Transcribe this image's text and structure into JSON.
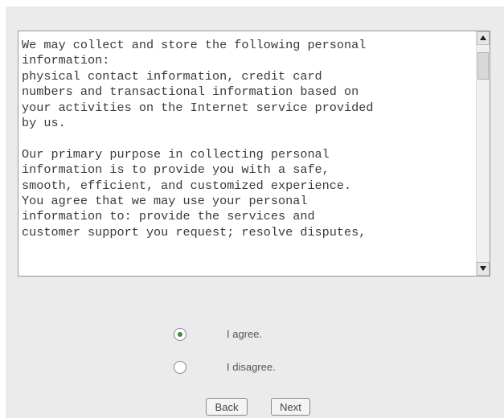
{
  "policy": {
    "lines": [
      "We may collect and store the following personal",
      "information:",
      "physical contact information, credit card",
      "numbers and transactional information based on",
      "your activities on the Internet service provided",
      "by us.",
      "",
      "Our primary purpose in collecting personal",
      "information is to provide you with a safe,",
      "smooth, efficient, and customized experience.",
      "You agree that we may use your personal",
      "information to: provide the services and",
      "customer support you request; resolve disputes,"
    ]
  },
  "options": {
    "agree_label": "I agree.",
    "disagree_label": "I disagree.",
    "selected": "agree"
  },
  "buttons": {
    "back_label": "Back",
    "next_label": "Next"
  }
}
